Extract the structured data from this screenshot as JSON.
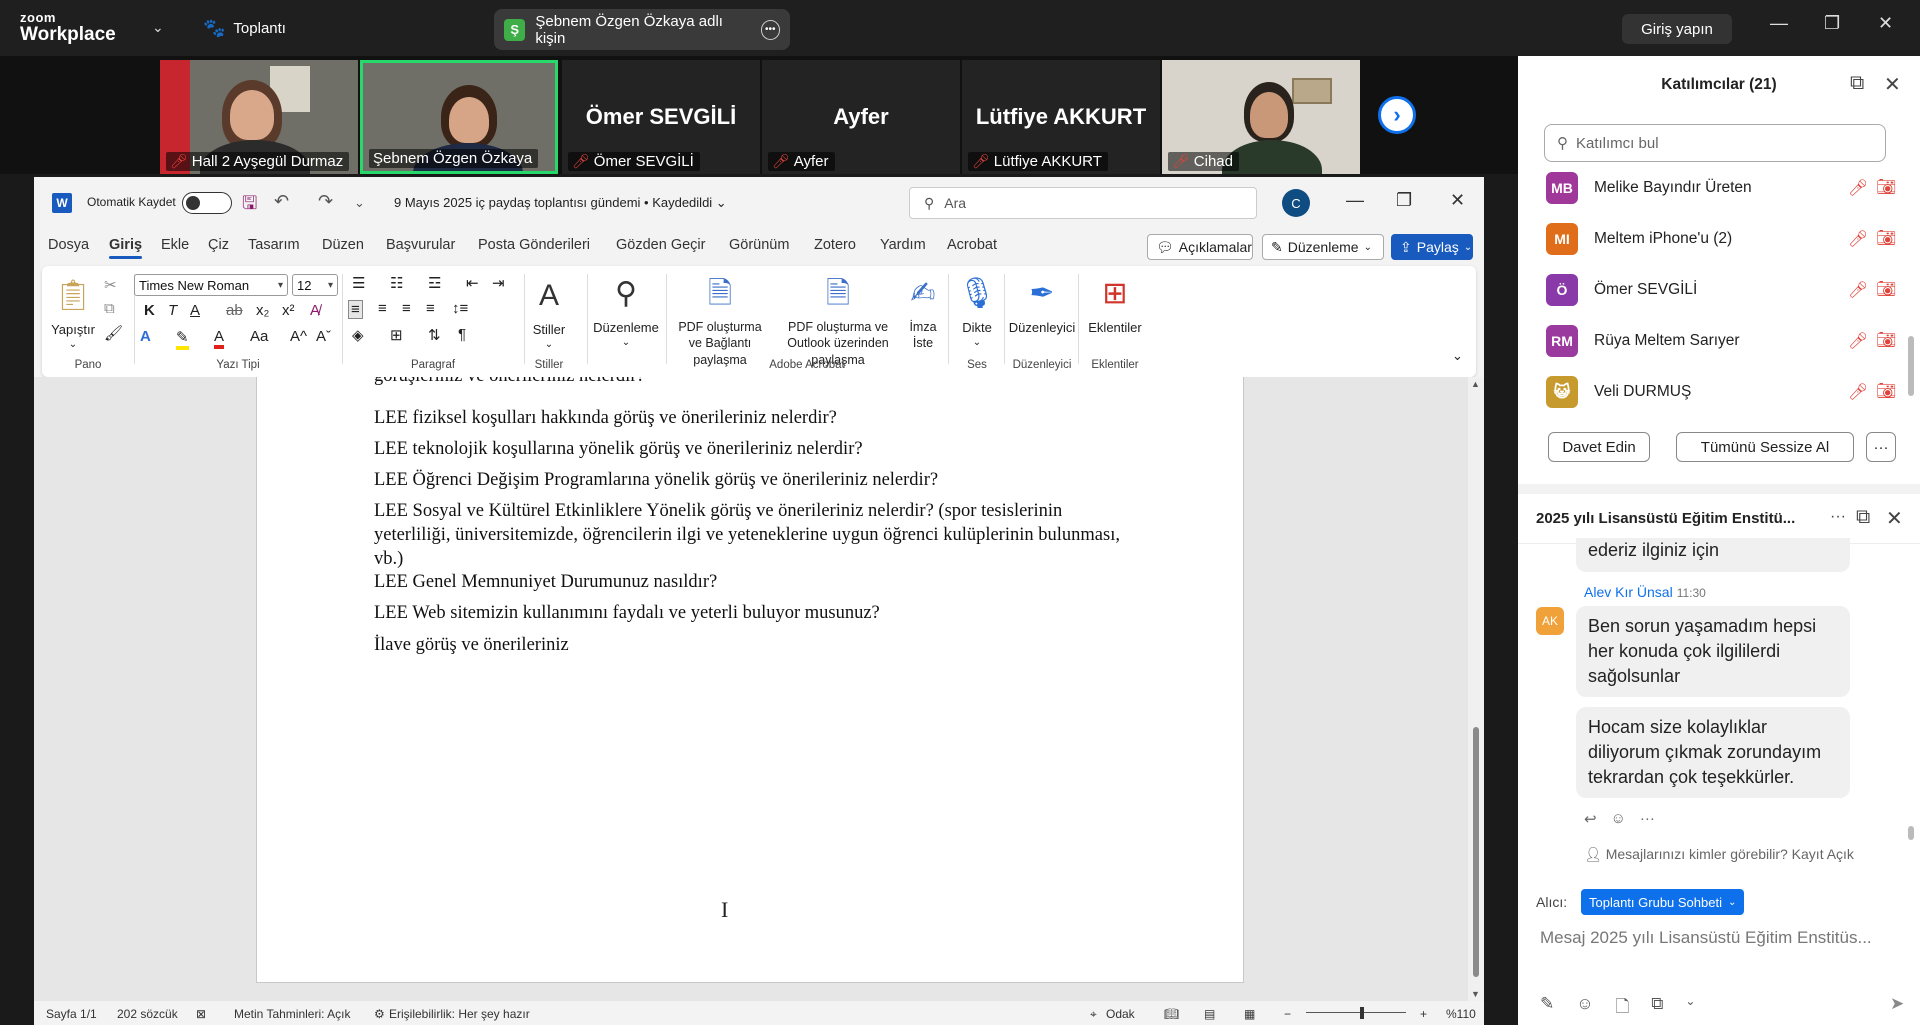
{
  "zoom": {
    "logo_line1": "zoom",
    "logo_line2": "Workplace",
    "meeting_label": "Toplantı",
    "share_badge": "Ş",
    "share_label": "Şebnem Özgen Özkaya adlı kişin",
    "signin_label": "Giriş yapın"
  },
  "video_tiles": [
    {
      "name": "Hall 2 Ayşegül Durmaz",
      "type": "camera"
    },
    {
      "name": "Şebnem Özgen Özkaya",
      "type": "camera",
      "active": true
    },
    {
      "name": "Ömer SEVGİLİ",
      "type": "name"
    },
    {
      "name": "Ayfer",
      "type": "name"
    },
    {
      "name": "Lütfiye AKKURT",
      "type": "name"
    },
    {
      "name": "Cihad",
      "type": "camera"
    }
  ],
  "word": {
    "logo": "W",
    "autosave_label": "Otomatik Kaydet",
    "doc_title": "9 Mayıs 2025 iç paydaş toplantısı gündemi • Kaydedildi ⌄",
    "search_placeholder": "Ara",
    "user_initial": "C",
    "tabs": [
      "Dosya",
      "Giriş",
      "Ekle",
      "Çiz",
      "Tasarım",
      "Düzen",
      "Başvurular",
      "Posta Gönderileri",
      "Gözden Geçir",
      "Görünüm",
      "Zotero",
      "Yardım",
      "Acrobat"
    ],
    "comments_btn": "Açıklamalar",
    "editing_btn": "Düzenleme",
    "share_btn": "Paylaş",
    "ribbon": {
      "paste": "Yapıştır",
      "group_pano": "Pano",
      "font_name": "Times New Roman",
      "font_size": "12",
      "group_font": "Yazı Tipi",
      "group_paragraph": "Paragraf",
      "styles": "Stiller",
      "group_styles": "Stiller",
      "editing": "Düzenleme",
      "pdf_share_link": "PDF oluşturma ve Bağlantı paylaşma",
      "pdf_share_outlook": "PDF oluşturma ve Outlook üzerinden paylaşma",
      "sign": "İmza İste",
      "group_adobe": "Adobe Acrobat",
      "dictate": "Dikte",
      "group_voice": "Ses",
      "editor": "Düzenleyici",
      "group_editor": "Düzenleyici",
      "addins": "Eklentiler",
      "group_addins": "Eklentiler"
    },
    "paragraphs": [
      "görüşleriniz ve önerileriniz nelerdir?",
      "LEE fiziksel koşulları hakkında görüş ve önerileriniz nelerdir?",
      "LEE teknolojik koşullarına yönelik görüş ve önerileriniz nelerdir?",
      "LEE Öğrenci Değişim Programlarına yönelik görüş ve önerileriniz nelerdir?",
      "LEE Sosyal ve Kültürel Etkinliklere Yönelik görüş ve önerileriniz nelerdir? (spor tesislerinin yeterliliği, üniversitemizde, öğrencilerin ilgi ve yeteneklerine uygun öğrenci kulüplerinin bulunması, vb.)",
      "LEE Genel Memnuniyet Durumunuz nasıldır?",
      "LEE Web sitemizin kullanımını faydalı ve yeterli buluyor musunuz?",
      "İlave görüş ve önerileriniz"
    ],
    "status": {
      "page": "Sayfa 1/1",
      "words": "202 sözcük",
      "predictions": "Metin Tahminleri: Açık",
      "accessibility": "Erişilebilirlik: Her şey hazır",
      "focus": "Odak",
      "zoom": "%110"
    }
  },
  "participants": {
    "title": "Katılımcılar (21)",
    "search_placeholder": "Katılımcı bul",
    "items": [
      {
        "initials": "MB",
        "name": "Melike Bayındır Üreten",
        "color": "#a0389a"
      },
      {
        "initials": "MI",
        "name": "Meltem iPhone'u (2)",
        "color": "#e06d1a"
      },
      {
        "initials": "Ö",
        "name": "Ömer SEVGİLİ",
        "color": "#8a3aa8"
      },
      {
        "initials": "RM",
        "name": "Rüya Meltem Sarıyer",
        "color": "#9a3a9e"
      },
      {
        "initials": "",
        "name": "Veli DURMUŞ",
        "color": "#c79a2e"
      }
    ],
    "invite_btn": "Davet Edin",
    "mute_all_btn": "Tümünü Sessize Al"
  },
  "chat": {
    "title": "2025 yılı Lisansüstü Eğitim Enstitü...",
    "msg_prev": "ederiz ilginiz için",
    "sender_initials": "AK",
    "sender": "Alev Kır Ünsal",
    "time": "11:30",
    "msg1": "Ben sorun yaşamadım hepsi her konuda çok ilgililerdi sağolsunlar",
    "msg2": "Hocam size kolaylıklar diliyorum çıkmak zorundayım tekrardan çok teşekkürler.",
    "visibility_note": "Mesajlarınızı kimler görebilir? Kayıt Açık",
    "to_label": "Alıcı:",
    "to_group": "Toplantı Grubu Sohbeti",
    "input_placeholder": "Mesaj 2025 yılı Lisansüstü Eğitim Enstitüs..."
  }
}
